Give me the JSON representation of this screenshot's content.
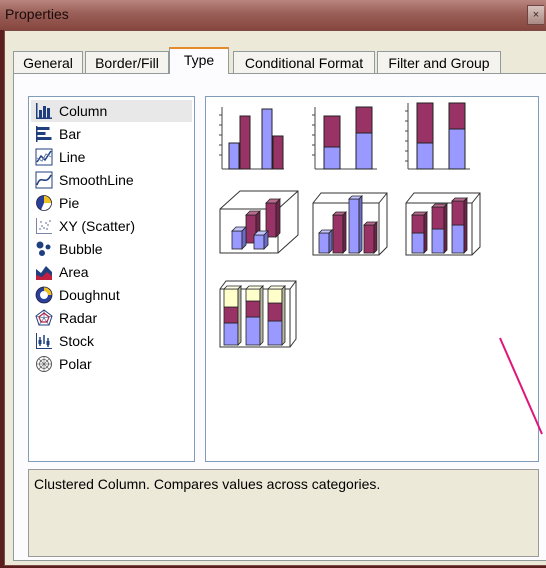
{
  "window": {
    "title": "Properties",
    "close_glyph": "×"
  },
  "tabs": [
    {
      "label": "General"
    },
    {
      "label": "Border/Fill"
    },
    {
      "label": "Type",
      "active": true
    },
    {
      "label": "Conditional Format"
    },
    {
      "label": "Filter and Group"
    }
  ],
  "chart_types": [
    {
      "label": "Column",
      "icon": "column-chart-icon",
      "selected": true
    },
    {
      "label": "Bar",
      "icon": "bar-chart-icon"
    },
    {
      "label": "Line",
      "icon": "line-chart-icon"
    },
    {
      "label": "SmoothLine",
      "icon": "smoothline-chart-icon"
    },
    {
      "label": "Pie",
      "icon": "pie-chart-icon"
    },
    {
      "label": "XY (Scatter)",
      "icon": "scatter-chart-icon"
    },
    {
      "label": "Bubble",
      "icon": "bubble-chart-icon"
    },
    {
      "label": "Area",
      "icon": "area-chart-icon"
    },
    {
      "label": "Doughnut",
      "icon": "doughnut-chart-icon"
    },
    {
      "label": "Radar",
      "icon": "radar-chart-icon"
    },
    {
      "label": "Stock",
      "icon": "stock-chart-icon"
    },
    {
      "label": "Polar",
      "icon": "polar-chart-icon"
    }
  ],
  "subtypes": [
    {
      "icon": "clustered-column-icon"
    },
    {
      "icon": "stacked-column-icon"
    },
    {
      "icon": "percent-stacked-column-icon"
    },
    {
      "icon": "clustered-column-3d-icon"
    },
    {
      "icon": "column-3d-icon"
    },
    {
      "icon": "stacked-column-3d-icon"
    },
    {
      "icon": "percent-stacked-column-3d-icon"
    }
  ],
  "description": "Clustered Column. Compares values across categories.",
  "colors": {
    "series1": "#9999ff",
    "series2": "#993366",
    "series3": "#ffffcc",
    "annotation": "#e0157a"
  }
}
